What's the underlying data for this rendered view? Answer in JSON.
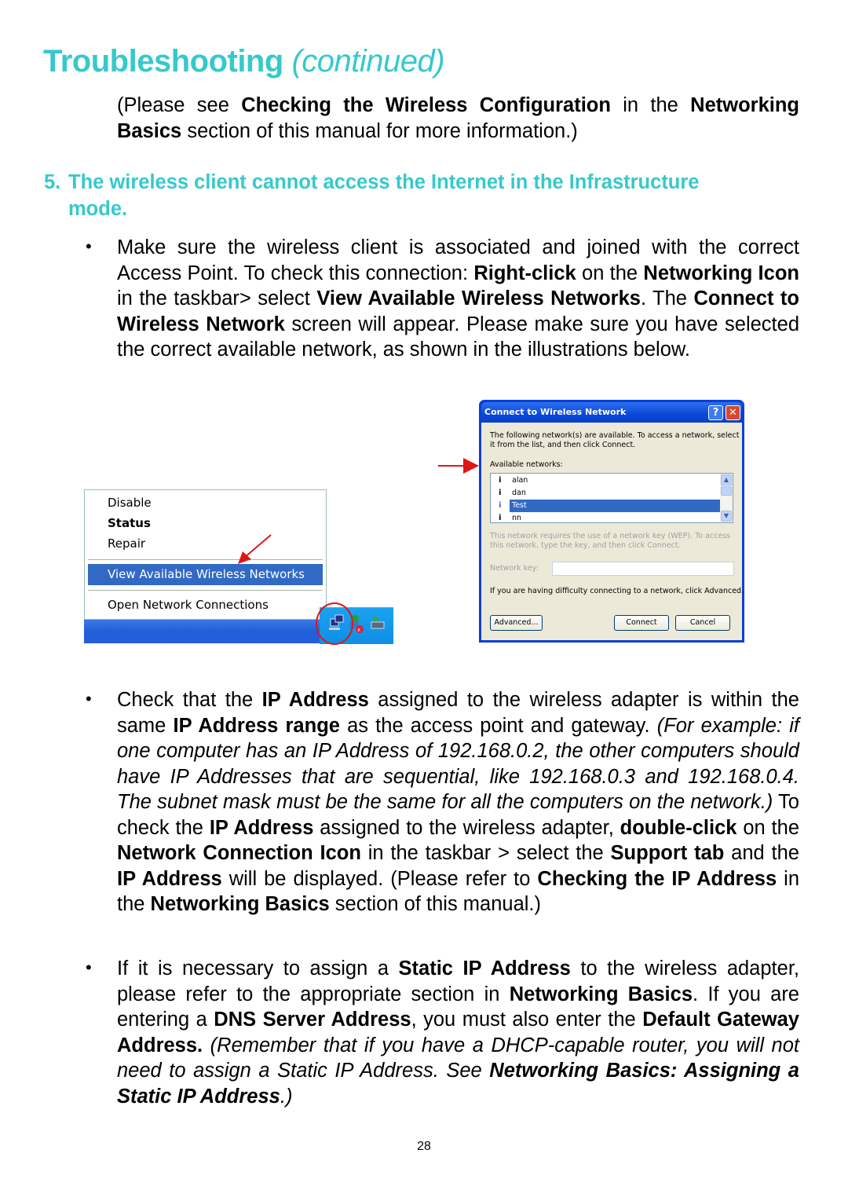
{
  "page": {
    "title_main": "Troubleshooting",
    "title_suffix": "(continued)",
    "page_number": "28",
    "accent_color": "#36c9cc"
  },
  "intro": {
    "t1": "(Please see ",
    "b1": "Checking the Wireless Configuration",
    "t2": " in the ",
    "b2": "Networking Basics",
    "t3": " section of this manual for more information.)"
  },
  "section5": {
    "number": "5.",
    "heading_line1": "The wireless client cannot access the Internet in the Infrastructure",
    "heading_line2": "mode."
  },
  "bullet1": {
    "t1": "Make sure the wireless client is associated and joined with the correct Access Point.  To check this connection:  ",
    "b1": "Right-click",
    "t2": " on the ",
    "b2": "Networking Icon",
    "t3": " in the taskbar> select ",
    "b3": "View Available Wireless Networks",
    "t4": ".  The ",
    "b4": "Connect to Wireless Network",
    "t5": " screen will appear. Please make sure you have selected the correct available network, as shown in the illustrations below."
  },
  "context_menu": {
    "items": [
      "Disable",
      "Status",
      "Repair",
      "View Available Wireless Networks",
      "Open Network Connections"
    ],
    "selected": "View Available Wireless Networks"
  },
  "dialog": {
    "title": "Connect to Wireless Network",
    "help_label": "?",
    "close_label": "✕",
    "intro": "The following network(s) are available. To access a network, select",
    "intro2": "it from the list, and then click Connect.",
    "available_label": "Available networks:",
    "networks": [
      "alan",
      "dan",
      "Test",
      "nn"
    ],
    "selected_network": "Test",
    "wep_note1": "This network requires the use of a network key (WEP). To access",
    "wep_note2": "this network, type the key, and then click Connect.",
    "key_label": "Network key:",
    "key_value": "",
    "advanced_hint": "If you are having difficulty connecting to a network, click Advanced.",
    "buttons": {
      "advanced": "Advanced...",
      "connect": "Connect",
      "cancel": "Cancel"
    }
  },
  "bullet2": {
    "t1": "Check that the ",
    "b1": "IP Address",
    "t2": " assigned to the wireless adapter is within the same ",
    "b2": "IP Address range",
    "t3": " as the access point and gateway.  ",
    "i1": "(For example:  if one computer has an IP Address of 192.168.0.2, the other computers should have IP Addresses that are sequential, like 192.168.0.3 and 192.168.0.4.  The subnet mask must be the same for all the computers on the network.)",
    "t4": "  To check the ",
    "b3": "IP Address",
    "t5": " assigned to the wireless adapter, ",
    "b4": "double-click",
    "t6": " on the ",
    "b5": "Network Connection Icon",
    "t7": " in the taskbar > select the ",
    "b6": "Support tab",
    "t8": " and the ",
    "b7": "IP Address",
    "t9": " will be displayed.  (Please refer to ",
    "b8": "Checking the IP Address",
    "t10": " in the ",
    "b9": "Networking Basics",
    "t11": " section of this manual.)"
  },
  "bullet3": {
    "t1": "If it is necessary to assign a ",
    "b1": "Static IP Address",
    "t2": " to the wireless adapter, please refer to the appropriate section in ",
    "b2": "Networking Basics",
    "t3": ".  If you are entering a ",
    "b3": "DNS Server Address",
    "t4": ", you must also enter the ",
    "b4": "Default Gateway Address.",
    "i1": "  (Remember that if you have a DHCP-capable router, you will not need to assign a Static IP Address. See ",
    "bi1": "Networking Basics: Assigning a Static IP Address",
    "i2": ".)"
  },
  "bullet_glyph": "•"
}
